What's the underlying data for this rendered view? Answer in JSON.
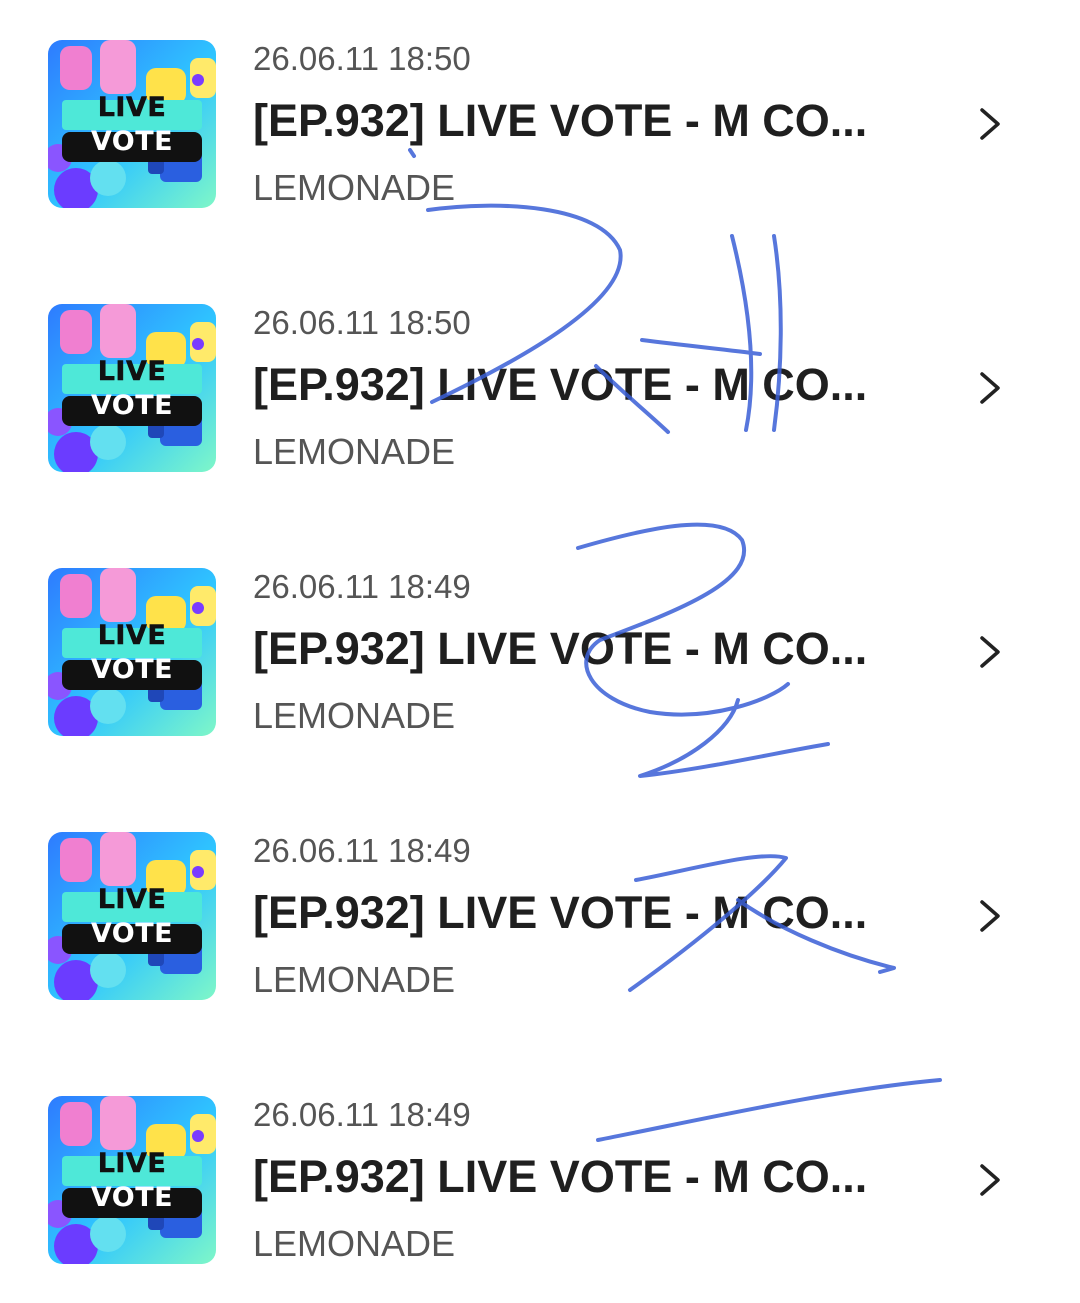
{
  "items": [
    {
      "date": "26.06.11 18:50",
      "title": "[EP.932] LIVE VOTE - M CO...",
      "channel": "LEMONADE",
      "thumb_line1": "LIVE",
      "thumb_line2": "VOTE"
    },
    {
      "date": "26.06.11 18:50",
      "title": "[EP.932] LIVE VOTE - M CO...",
      "channel": "LEMONADE",
      "thumb_line1": "LIVE",
      "thumb_line2": "VOTE"
    },
    {
      "date": "26.06.11 18:49",
      "title": "[EP.932] LIVE VOTE - M CO...",
      "channel": "LEMONADE",
      "thumb_line1": "LIVE",
      "thumb_line2": "VOTE"
    },
    {
      "date": "26.06.11 18:49",
      "title": "[EP.932] LIVE VOTE - M CO...",
      "channel": "LEMONADE",
      "thumb_line1": "LIVE",
      "thumb_line2": "VOTE"
    },
    {
      "date": "26.06.11 18:49",
      "title": "[EP.932] LIVE VOTE - M CO...",
      "channel": "LEMONADE",
      "thumb_line1": "LIVE",
      "thumb_line2": "VOTE"
    }
  ],
  "icons": {
    "chevron": "chevron-right-icon"
  },
  "colors": {
    "title": "#1f1f1f",
    "meta": "#555555",
    "scribble": "#3a5fd6",
    "thumb_bg_top": "#2ea8ff",
    "thumb_bg_bottom": "#5ff0d8",
    "thumb_banner": "#4ee8d8"
  }
}
